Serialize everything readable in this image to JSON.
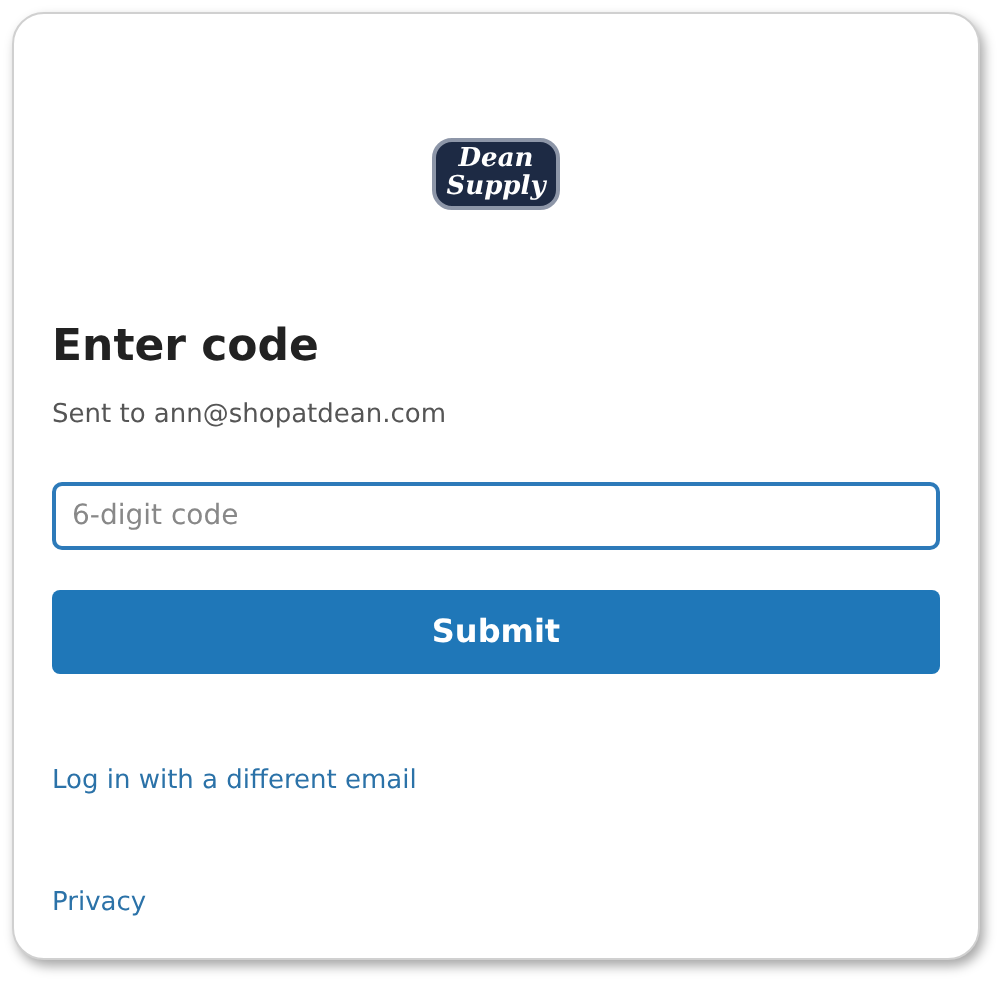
{
  "logo": {
    "lines": [
      "Dean",
      "Supply"
    ]
  },
  "title": "Enter code",
  "subtitle": "Sent to ann@shopatdean.com",
  "code_field": {
    "placeholder": "6-digit code",
    "focused": true
  },
  "submit_button": "Submit",
  "alt_link": "Log in with a different email",
  "footer_link": "Privacy"
}
